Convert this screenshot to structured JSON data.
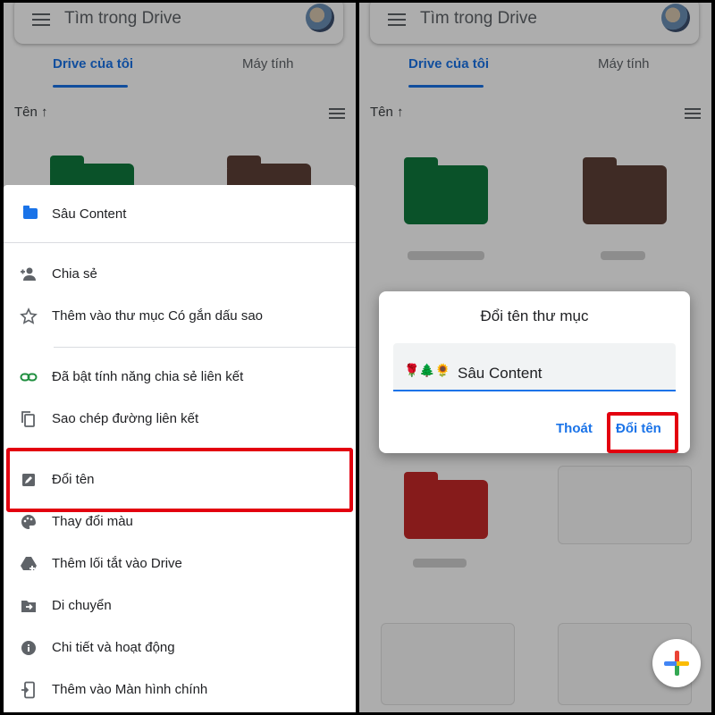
{
  "left": {
    "search_placeholder": "Tìm trong Drive",
    "tabs": [
      "Drive của tôi",
      "Máy tính"
    ],
    "sort_label": "Tên ↑",
    "sheet": {
      "header_title": "Sâu Content",
      "items": [
        {
          "label": "Chia sẻ",
          "icon": "person-add-icon"
        },
        {
          "label": "Thêm vào thư mục Có gắn dấu sao",
          "icon": "star-icon"
        },
        {
          "label": "Đã bật tính năng chia sẻ liên kết",
          "icon": "link-icon"
        },
        {
          "label": "Sao chép đường liên kết",
          "icon": "copy-icon"
        },
        {
          "label": "Đổi tên",
          "icon": "edit-icon"
        },
        {
          "label": "Thay đổi màu",
          "icon": "palette-icon"
        },
        {
          "label": "Thêm lối tắt vào Drive",
          "icon": "drive-shortcut-icon"
        },
        {
          "label": "Di chuyển",
          "icon": "move-icon"
        },
        {
          "label": "Chi tiết và hoạt động",
          "icon": "info-icon"
        },
        {
          "label": "Thêm vào Màn hình chính",
          "icon": "add-to-home-icon"
        }
      ]
    }
  },
  "right": {
    "search_placeholder": "Tìm trong Drive",
    "tabs": [
      "Drive của tôi",
      "Máy tính"
    ],
    "sort_label": "Tên ↑",
    "dialog": {
      "title": "Đổi tên thư mục",
      "emoji_prefix": "🌹🌲🌻",
      "field_value": "Sâu Content",
      "cancel_label": "Thoát",
      "confirm_label": "Đổi tên"
    }
  },
  "colors": {
    "accent": "#1a73e8",
    "highlight": "#e3000f",
    "folder_green": "#0f7a3d",
    "folder_brown": "#5d4037",
    "folder_red": "#c62828"
  }
}
